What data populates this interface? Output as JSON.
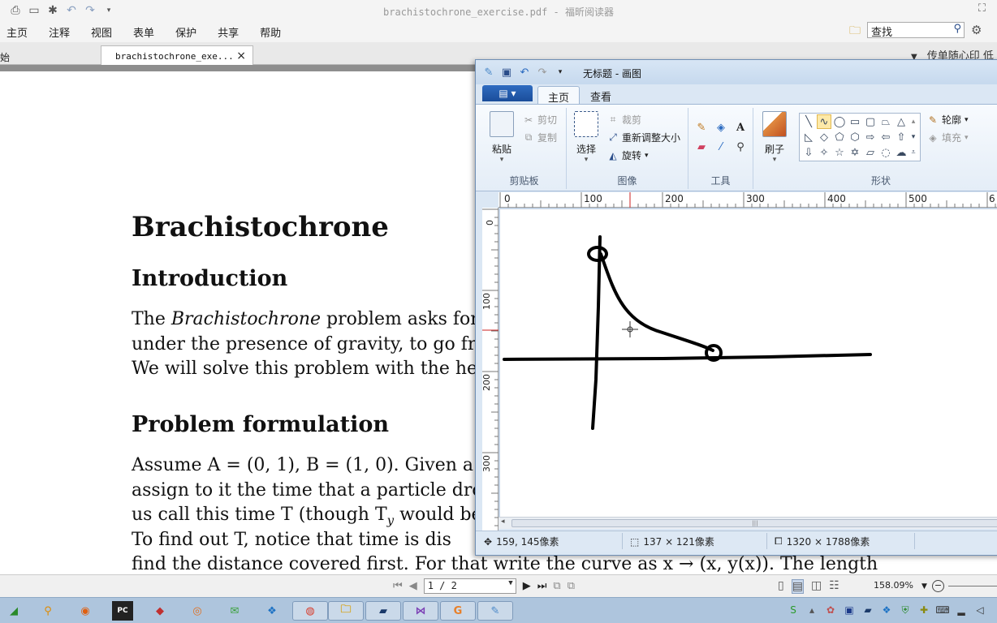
{
  "foxit": {
    "title": "brachistochrone_exercise.pdf - 福昕阅读器",
    "menu": [
      "主页",
      "注释",
      "视图",
      "表单",
      "保护",
      "共享",
      "帮助"
    ],
    "search_value": "查找",
    "tabs": [
      {
        "label": "始"
      },
      {
        "label": "brachistochrone_exe..."
      }
    ],
    "tab_close": "×",
    "ad_text": "传单随心印 低",
    "dropdown_arrow": "▼"
  },
  "document": {
    "title": "Brachistochrone",
    "section1": "Introduction",
    "intro_lines": [
      [
        "The ",
        "Brachistochrone",
        " problem asks for"
      ],
      [
        "under the presence of gravity, to go fro"
      ],
      [
        "We will solve this problem with the hel"
      ]
    ],
    "section2": "Problem formulation",
    "problem_lines": [
      "Assume A = (0, 1), B = (1, 0). Given a",
      "assign to it the time that a particle dro",
      "us call this time T (though T",
      "To find out T, notice that time is dis",
      "find the distance covered first.  For that write the curve as x → (x, y(x)).  The length"
    ],
    "problem_line3_sub": "y",
    "problem_line3_tail": " would be"
  },
  "statusbar": {
    "page_value": "1 / 2",
    "zoom": "158.09%"
  },
  "paint": {
    "title": "无标题 - 画图",
    "file_button": "▤ ▾",
    "tab_home": "主页",
    "tab_view": "查看",
    "clipboard": {
      "paste": "粘贴",
      "cut": "剪切",
      "copy": "复制",
      "label": "剪贴板"
    },
    "image": {
      "select": "选择",
      "crop": "裁剪",
      "resize": "重新调整大小",
      "rotate": "旋转",
      "label": "图像"
    },
    "tools_label": "工具",
    "brushes": "刷子",
    "shapes": {
      "outline": "轮廓",
      "fill": "填充",
      "label": "形状"
    },
    "ruler_h": [
      "0",
      "100",
      "200",
      "300",
      "400",
      "500",
      "6"
    ],
    "ruler_v": [
      "0",
      "100",
      "200",
      "300"
    ],
    "status": {
      "cursor_pos": "159, 145像素",
      "selection_size": "137 × 121像素",
      "image_size": "1320 × 1788像素"
    }
  },
  "colors": {
    "paint_accent": "#1a4d9a",
    "ruler_marker": "#cc2222",
    "taskbar": "#aec5dd"
  }
}
